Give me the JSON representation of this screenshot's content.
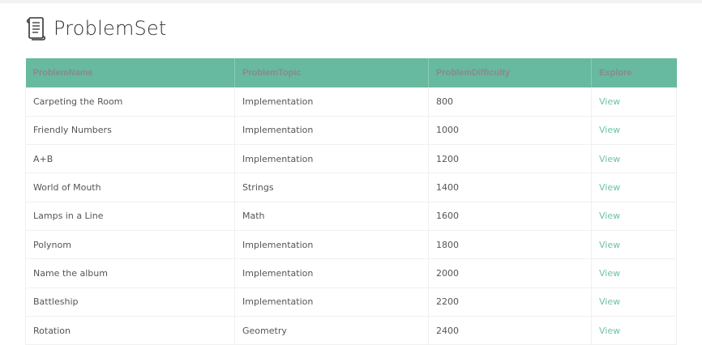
{
  "app": {
    "title": "ProblemSet",
    "logo_icon": "scroll-icon"
  },
  "table": {
    "columns": [
      "ProblemName",
      "ProblemTopic",
      "ProblemDifficulty",
      "Explore"
    ],
    "rows": [
      {
        "name": "Carpeting the Room",
        "topic": "Implementation",
        "difficulty": "800",
        "link": "View"
      },
      {
        "name": "Friendly Numbers",
        "topic": "Implementation",
        "difficulty": "1000",
        "link": "View"
      },
      {
        "name": "A+B",
        "topic": "Implementation",
        "difficulty": "1200",
        "link": "View"
      },
      {
        "name": "World of Mouth",
        "topic": "Strings",
        "difficulty": "1400",
        "link": "View"
      },
      {
        "name": "Lamps in a Line",
        "topic": "Math",
        "difficulty": "1600",
        "link": "View"
      },
      {
        "name": "Polynom",
        "topic": "Implementation",
        "difficulty": "1800",
        "link": "View"
      },
      {
        "name": "Name the album",
        "topic": "Implementation",
        "difficulty": "2000",
        "link": "View"
      },
      {
        "name": "Battleship",
        "topic": "Implementation",
        "difficulty": "2200",
        "link": "View"
      },
      {
        "name": "Rotation",
        "topic": "Geometry",
        "difficulty": "2400",
        "link": "View"
      }
    ]
  },
  "colors": {
    "header_bg": "#67b9a0",
    "link": "#6cc3a3"
  }
}
